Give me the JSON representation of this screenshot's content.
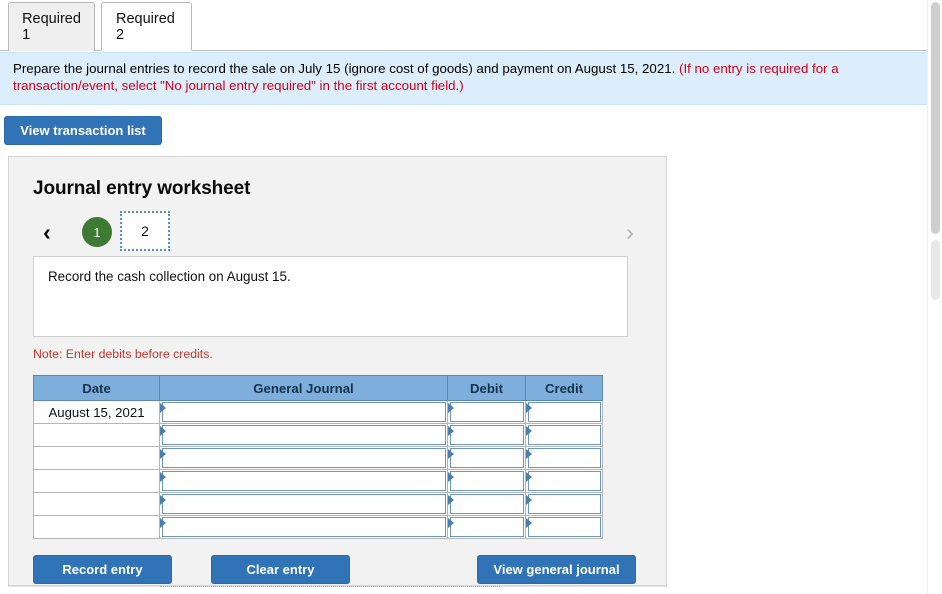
{
  "tabs": [
    {
      "label": "Required 1",
      "active": false
    },
    {
      "label": "Required 2",
      "active": true
    }
  ],
  "instruction": {
    "main": "Prepare the journal entries to record the sale on July 15 (ignore cost of goods) and payment on August 15, 2021.",
    "paren": "(If no entry is required for a transaction/event, select \"No journal entry required\" in the first account field.)"
  },
  "toolbar": {
    "view_transaction_list": "View transaction list"
  },
  "worksheet": {
    "title": "Journal entry worksheet",
    "pager": {
      "prev_icon": "chevron-left-icon",
      "next_icon": "chevron-right-icon",
      "steps": [
        {
          "label": "1",
          "state": "completed"
        },
        {
          "label": "2",
          "state": "active"
        }
      ]
    },
    "description": "Record the cash collection on August 15.",
    "note": "Note: Enter debits before credits.",
    "table": {
      "columns": [
        "Date",
        "General Journal",
        "Debit",
        "Credit"
      ],
      "rows": [
        {
          "date": "August 15, 2021",
          "journal": "",
          "debit": "",
          "credit": ""
        },
        {
          "date": "",
          "journal": "",
          "debit": "",
          "credit": ""
        },
        {
          "date": "",
          "journal": "",
          "debit": "",
          "credit": ""
        },
        {
          "date": "",
          "journal": "",
          "debit": "",
          "credit": ""
        },
        {
          "date": "",
          "journal": "",
          "debit": "",
          "credit": ""
        },
        {
          "date": "",
          "journal": "",
          "debit": "",
          "credit": ""
        }
      ]
    },
    "buttons": {
      "record_entry": "Record entry",
      "clear_entry": "Clear entry",
      "view_general_journal": "View general journal"
    }
  },
  "colors": {
    "primary_button": "#3073b7",
    "banner_background": "#dcedfb",
    "alert_text": "#d0021b",
    "table_header": "#7eaedb",
    "step_completed": "#3d7a33"
  }
}
